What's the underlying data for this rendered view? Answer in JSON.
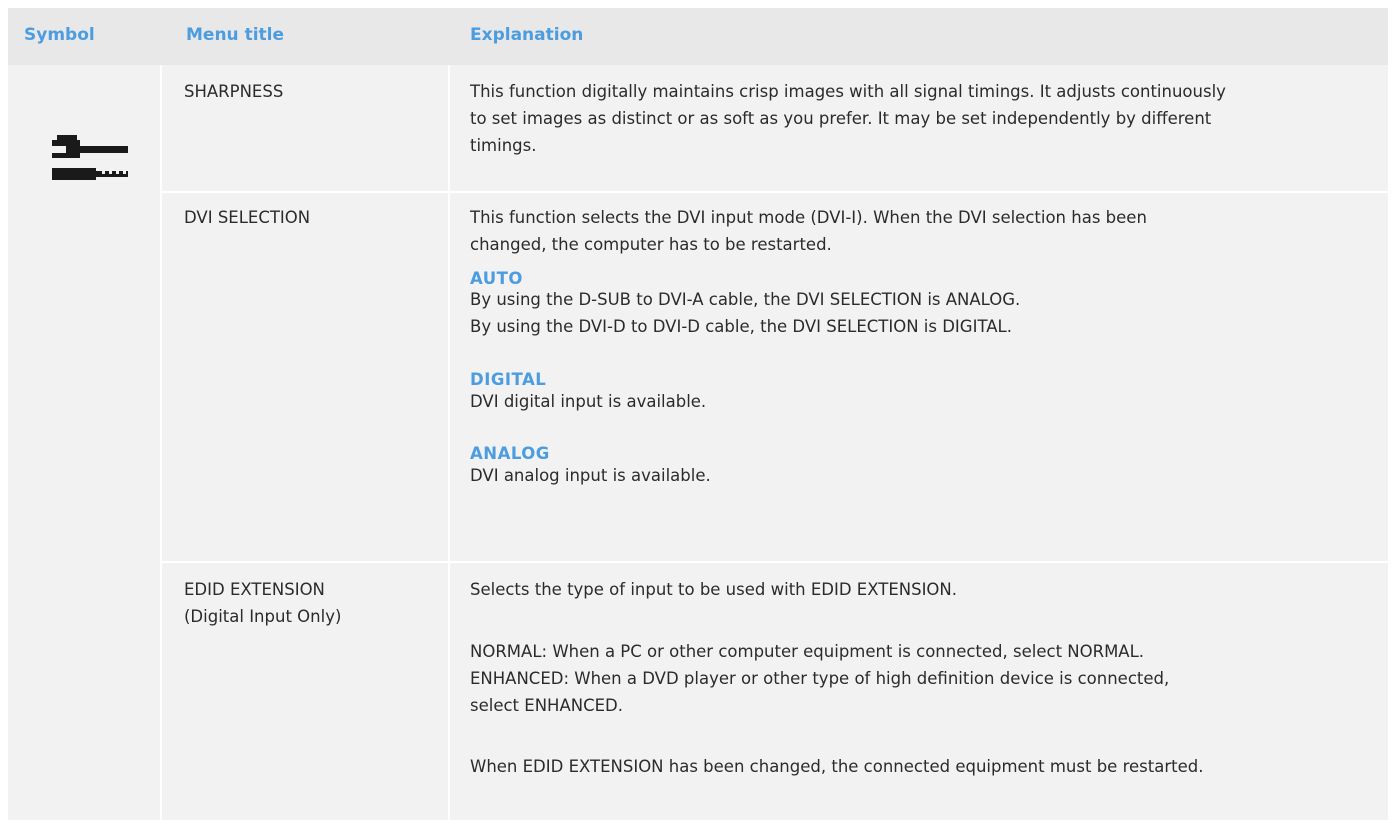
{
  "header": {
    "symbol": "Symbol",
    "menu_title": "Menu title",
    "explanation": "Explanation"
  },
  "rows": [
    {
      "menu_title": "SHARPNESS",
      "explanation_lines": [
        "This function digitally maintains crisp images with all signal timings. It adjusts continuously",
        "to set images as distinct or as soft as you prefer. It may be set independently by different",
        "timings."
      ]
    },
    {
      "menu_title": "DVI SELECTION",
      "intro_lines": [
        "This function selects the DVI input mode (DVI-I). When the DVI selection has been",
        "changed, the computer has to be restarted."
      ],
      "options": [
        {
          "heading": "AUTO",
          "lines": [
            "By using the D-SUB to DVI-A cable, the DVI SELECTION is ANALOG.",
            "By using the DVI-D to DVI-D cable, the DVI SELECTION is DIGITAL."
          ]
        },
        {
          "heading": "DIGITAL",
          "lines": [
            "DVI digital input is available."
          ]
        },
        {
          "heading": "ANALOG",
          "lines": [
            "DVI analog input is available."
          ]
        }
      ]
    },
    {
      "menu_title": "EDID EXTENSION",
      "menu_subtitle": "(Digital Input Only)",
      "lines": [
        "Selects the type of input to be used with EDID EXTENSION.",
        "NORMAL: When a PC or other computer equipment is connected, select NORMAL.",
        "ENHANCED: When a DVD player or other type of high definition device is connected,",
        "select ENHANCED.",
        "When EDID EXTENSION has been changed, the connected equipment must be restarted."
      ]
    }
  ],
  "icons": {
    "symbol": "wrench-icon"
  },
  "colors": {
    "accent": "#4c9ce0",
    "table_bg": "#f2f2f2",
    "header_bg": "#e8e8e8"
  }
}
